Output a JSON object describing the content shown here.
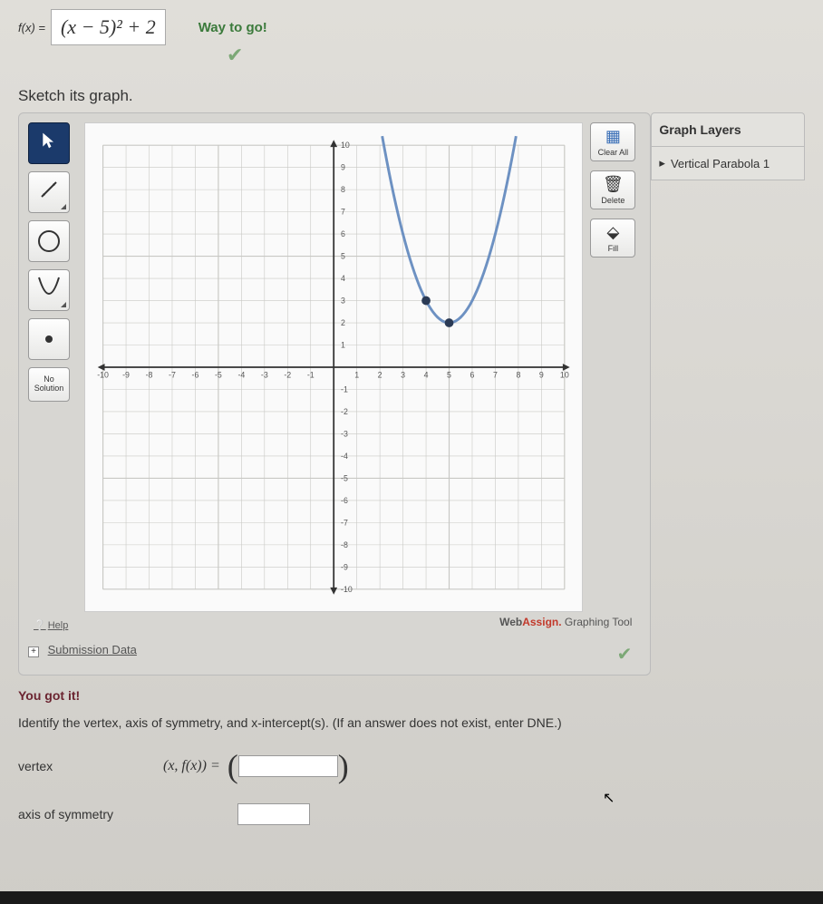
{
  "formula": {
    "lhs": "f(x) =",
    "rhs": "(x − 5)² + 2"
  },
  "feedback": {
    "way_to_go": "Way to go!",
    "you_got_it": "You got it!"
  },
  "sketch_label": "Sketch its graph.",
  "toolbar": {
    "no_solution_line1": "No",
    "no_solution_line2": "Solution"
  },
  "right_tools": {
    "clear_all": "Clear All",
    "delete": "Delete",
    "fill": "Fill"
  },
  "help_label": "Help",
  "watermark": {
    "prefix": "Web",
    "assign": "Assign.",
    "suffix": " Graphing Tool"
  },
  "submission_label": "Submission Data",
  "identify_text": "Identify the vertex, axis of symmetry, and x-intercept(s). (If an answer does not exist, enter DNE.)",
  "answers": {
    "vertex_label": "vertex",
    "vertex_prefix": "(x, f(x))  =",
    "axis_label": "axis of symmetry"
  },
  "layers": {
    "header": "Graph Layers",
    "item1": "Vertical Parabola 1"
  },
  "chart_data": {
    "type": "line",
    "title": "",
    "xlabel": "",
    "ylabel": "",
    "xlim": [
      -10,
      10
    ],
    "ylim": [
      -10,
      10
    ],
    "x_ticks": [
      -10,
      -9,
      -8,
      -7,
      -6,
      -5,
      -4,
      -3,
      -2,
      -1,
      1,
      2,
      3,
      4,
      5,
      6,
      7,
      8,
      9,
      10
    ],
    "y_ticks": [
      -10,
      -9,
      -8,
      -7,
      -6,
      -5,
      -4,
      -3,
      -2,
      -1,
      1,
      2,
      3,
      4,
      5,
      6,
      7,
      8,
      9,
      10
    ],
    "series": [
      {
        "name": "Vertical Parabola 1",
        "color": "#6d91c2",
        "x": [
          2,
          3,
          4,
          5,
          6,
          7,
          8
        ],
        "y": [
          11,
          6,
          3,
          2,
          3,
          6,
          11
        ]
      }
    ],
    "points": [
      {
        "x": 4,
        "y": 3
      },
      {
        "x": 5,
        "y": 2
      }
    ]
  }
}
